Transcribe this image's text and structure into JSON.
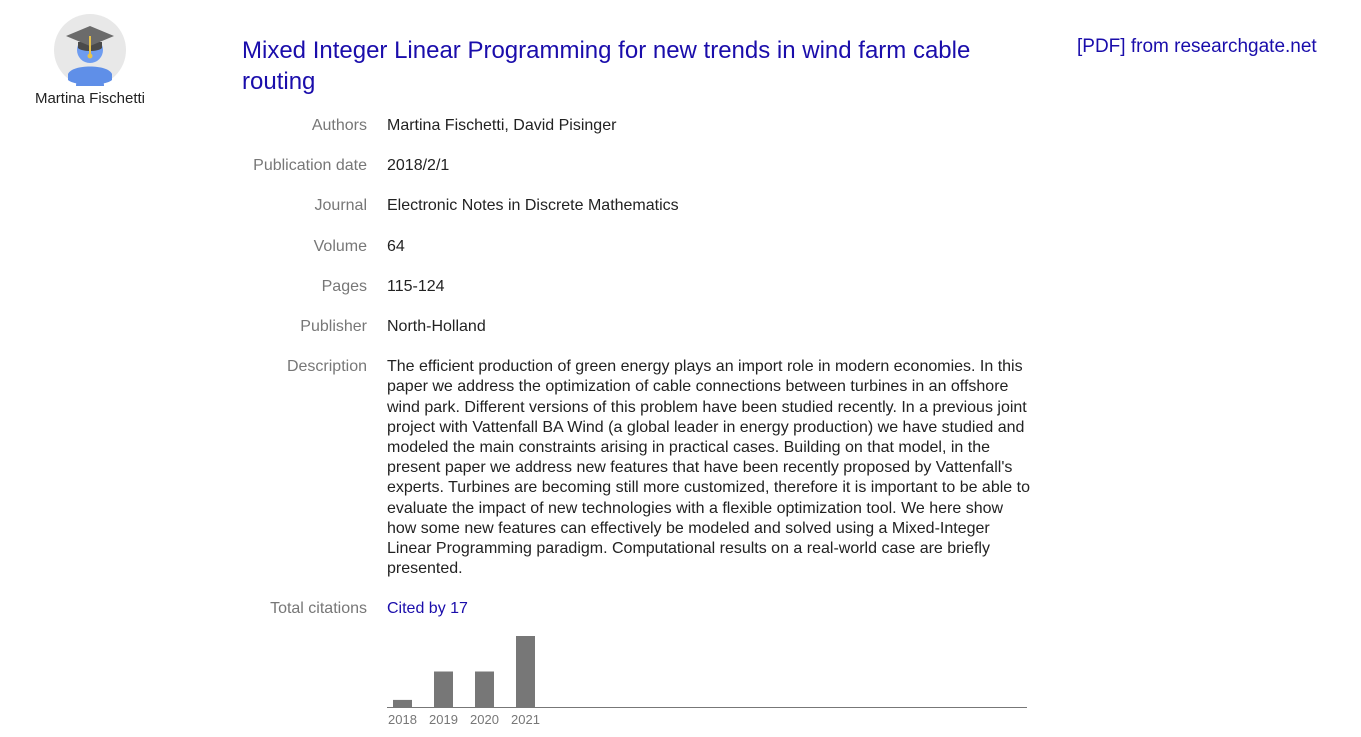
{
  "profile": {
    "name": "Martina Fischetti",
    "avatar_icon": "graduate-avatar-icon"
  },
  "article": {
    "title": "Mixed Integer Linear Programming for new trends in wind farm cable routing",
    "pdf_link": "[PDF] from researchgate.net"
  },
  "fields": [
    {
      "label": "Authors",
      "value": "Martina Fischetti, David Pisinger"
    },
    {
      "label": "Publication date",
      "value": "2018/2/1"
    },
    {
      "label": "Journal",
      "value": "Electronic Notes in Discrete Mathematics"
    },
    {
      "label": "Volume",
      "value": "64"
    },
    {
      "label": "Pages",
      "value": "115-124"
    },
    {
      "label": "Publisher",
      "value": "North-Holland"
    },
    {
      "label": "Description",
      "value": "The efficient production of green energy plays an import role in modern economies. In this paper we address the optimization of cable connections between turbines in an offshore wind park. Different versions of this problem have been studied recently. In a previous joint project with Vattenfall BA Wind (a global leader in energy production) we have studied and modeled the main constraints arising in practical cases. Building on that model, in the present paper we address new features that have been recently proposed by Vattenfall's experts. Turbines are becoming still more customized, therefore it is important to be able to evaluate the impact of new technologies with a flexible optimization tool. We here show how some new features can effectively be modeled and solved using a Mixed-Integer Linear Programming paradigm. Computational results on a real-world case are briefly presented."
    },
    {
      "label": "Total citations",
      "value": "Cited by 17"
    }
  ],
  "colors": {
    "link": "#1a0dab",
    "label": "#777777",
    "bar": "#777777"
  },
  "chart_data": {
    "type": "bar",
    "categories": [
      "2018",
      "2019",
      "2020",
      "2021"
    ],
    "values": [
      1,
      5,
      5,
      10
    ],
    "ylim": [
      0,
      10
    ],
    "title": "",
    "xlabel": "",
    "ylabel": "",
    "grid": false
  }
}
